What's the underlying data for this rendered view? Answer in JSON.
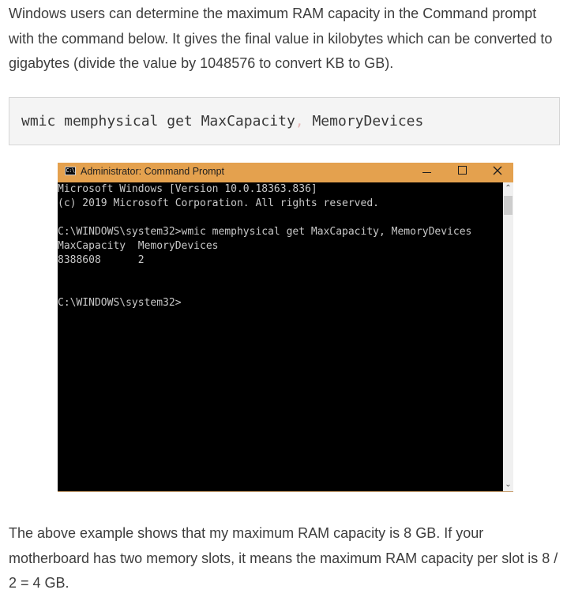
{
  "intro_text": "Windows users can determine the maximum RAM capacity in the Command prompt with the command below. It gives the final value in kilobytes which can be converted to gigabytes (divide the value by 1048576 to convert KB to GB).",
  "code_block": {
    "part1": "wmic memphysical get MaxCapacity",
    "comma": ",",
    "part2": " MemoryDevices"
  },
  "cmd_window": {
    "title": "Administrator: Command Prompt",
    "icon_text": "C:\\",
    "console_lines": [
      "Microsoft Windows [Version 10.0.18363.836]",
      "(c) 2019 Microsoft Corporation. All rights reserved.",
      "",
      "C:\\WINDOWS\\system32>wmic memphysical get MaxCapacity, MemoryDevices",
      "MaxCapacity  MemoryDevices",
      "8388608      2",
      "",
      "",
      "C:\\WINDOWS\\system32>"
    ],
    "scroll_up_glyph": "⌃",
    "scroll_down_glyph": "⌄"
  },
  "outro_text": "The above example shows that my maximum RAM capacity is 8 GB. If your motherboard has two memory slots, it means the maximum RAM capacity per slot is 8 / 2 = 4 GB."
}
